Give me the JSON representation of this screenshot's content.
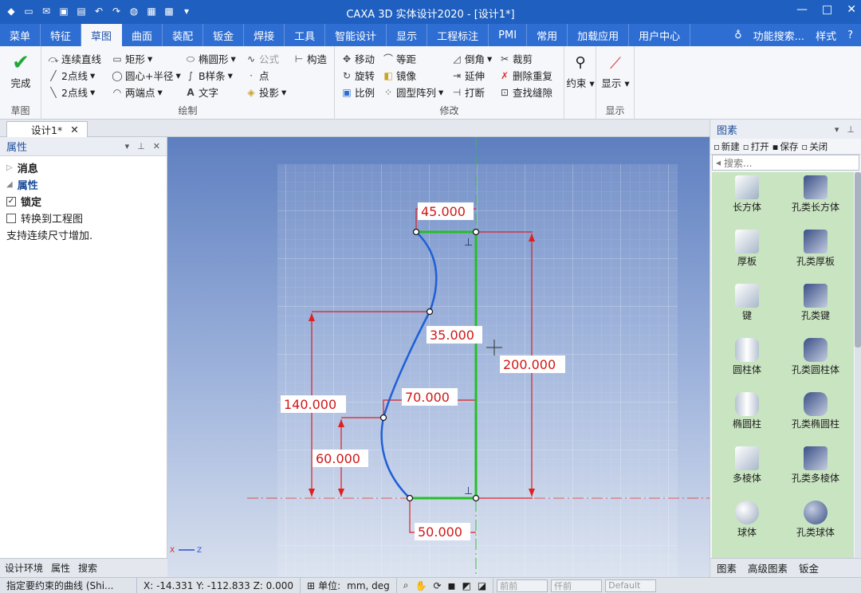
{
  "app": {
    "title": "CAXA 3D 实体设计2020 - [设计1*]",
    "window_controls": [
      "—",
      "□",
      "✕"
    ]
  },
  "tabs": [
    "菜单",
    "特征",
    "草图",
    "曲面",
    "装配",
    "钣金",
    "焊接",
    "工具",
    "智能设计",
    "显示",
    "工程标注",
    "PMI",
    "常用",
    "加载应用",
    "用户中心"
  ],
  "active_tab": "草图",
  "tabs_right": {
    "search": "功能搜索...",
    "style": "样式"
  },
  "ribbon": {
    "finish": {
      "label": "完成",
      "group": "草图"
    },
    "draw": {
      "group": "绘制",
      "items": [
        "连续直线",
        "矩形",
        "椭圆形",
        "公式",
        "构造",
        "2点线",
        "圆心+半径",
        "B样条",
        "点",
        "2点线",
        "两端点",
        "文字",
        "投影"
      ]
    },
    "modify": {
      "group": "修改",
      "items": [
        "移动",
        "等距",
        "倒角",
        "裁剪",
        "旋转",
        "镜像",
        "延伸",
        "删除重复",
        "比例",
        "圆型阵列",
        "打断",
        "查找缝隙"
      ]
    },
    "constraint": {
      "label": "约束"
    },
    "display": {
      "label": "显示",
      "group": "显示"
    }
  },
  "document_tab": "设计1*",
  "left_panel": {
    "title": "属性",
    "items": [
      {
        "type": "expand",
        "label": "消息"
      },
      {
        "type": "expand-open",
        "label": "属性"
      },
      {
        "type": "checkbox",
        "label": "锁定",
        "checked": true
      },
      {
        "type": "checkbox",
        "label": "转换到工程图",
        "checked": false
      }
    ],
    "message": "支持连续尺寸增加.",
    "bottom_tabs": [
      "设计环境",
      "属性",
      "搜索"
    ]
  },
  "viewport": {
    "dimensions": [
      "45.000",
      "35.000",
      "200.000",
      "70.000",
      "140.000",
      "60.000",
      "50.000"
    ],
    "axis_labels": [
      "X",
      "Z"
    ]
  },
  "right_panel": {
    "title": "图素",
    "toolbar": [
      "新建",
      "打开",
      "保存",
      "关闭"
    ],
    "search_placeholder": "搜索...",
    "items": [
      "长方体",
      "孔类长方体",
      "厚板",
      "孔类厚板",
      "键",
      "孔类键",
      "圆柱体",
      "孔类圆柱体",
      "椭圆柱",
      "孔类椭圆柱",
      "多棱体",
      "孔类多棱体",
      "球体",
      "孔类球体"
    ],
    "bottom_tabs": [
      "图素",
      "高级图素",
      "钣金"
    ]
  },
  "status_bar": {
    "prompt": "指定要约束的曲线 (Shi...",
    "coords": "X: -14.331 Y: -112.833 Z: 0.000",
    "unit_label": "单位:",
    "unit_value": "mm, deg",
    "dropdowns": [
      "前前",
      "仟前",
      "Default"
    ]
  },
  "colors": {
    "titlebar": "#1f5fbf",
    "tabbar": "#2e6ed3",
    "profile_curve": "#1f5fd6",
    "constraint_line": "#23c023",
    "dimension": "#e02020",
    "palette_bg": "#c9e4c1"
  }
}
